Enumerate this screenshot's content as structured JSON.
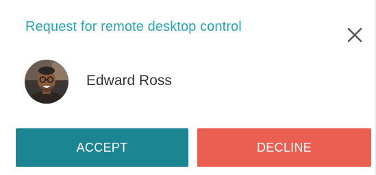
{
  "dialog": {
    "title": "Request for remote desktop control",
    "close_icon": "close-icon"
  },
  "requester": {
    "name": "Edward Ross",
    "avatar_icon": "user-avatar"
  },
  "actions": {
    "accept_label": "ACCEPT",
    "decline_label": "DECLINE"
  },
  "colors": {
    "title": "#28a3b6",
    "accept": "#1b8591",
    "decline": "#ea5f52",
    "text": "#333333",
    "close_icon": "#555555"
  }
}
